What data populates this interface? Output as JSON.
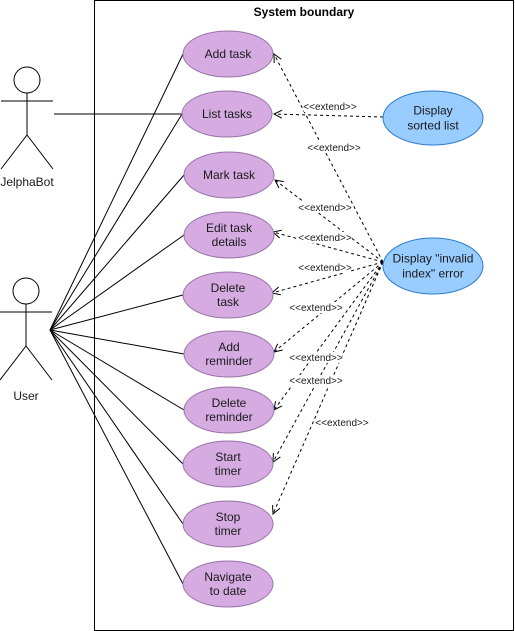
{
  "diagram": {
    "boundary_title": "System boundary",
    "colors": {
      "use_case_fill": "#d5abe2",
      "use_case_stroke": "#9673a6",
      "extension_fill": "#99ccff",
      "extension_stroke": "#2b7bd1"
    },
    "actors": [
      {
        "id": "jelphabot",
        "name": "JelphaBot"
      },
      {
        "id": "user",
        "name": "User"
      }
    ],
    "use_cases": [
      {
        "id": "add-task",
        "lines": [
          "Add task"
        ]
      },
      {
        "id": "list-tasks",
        "lines": [
          "List tasks"
        ]
      },
      {
        "id": "mark-task",
        "lines": [
          "Mark task"
        ]
      },
      {
        "id": "edit-task-details",
        "lines": [
          "Edit task",
          "details"
        ]
      },
      {
        "id": "delete-task",
        "lines": [
          "Delete",
          "task"
        ]
      },
      {
        "id": "add-reminder",
        "lines": [
          "Add",
          "reminder"
        ]
      },
      {
        "id": "delete-reminder",
        "lines": [
          "Delete",
          "reminder"
        ]
      },
      {
        "id": "start-timer",
        "lines": [
          "Start",
          "timer"
        ]
      },
      {
        "id": "stop-timer",
        "lines": [
          "Stop",
          "timer"
        ]
      },
      {
        "id": "navigate-to-date",
        "lines": [
          "Navigate",
          "to date"
        ]
      }
    ],
    "extension_cases": [
      {
        "id": "display-sorted-list",
        "lines": [
          "Display",
          "sorted list"
        ]
      },
      {
        "id": "display-invalid-index-error",
        "lines": [
          "Display \"invalid",
          "index\" error"
        ]
      }
    ],
    "associations": [
      {
        "from": "jelphabot",
        "to": "list-tasks"
      },
      {
        "from": "user",
        "to": "add-task"
      },
      {
        "from": "user",
        "to": "list-tasks"
      },
      {
        "from": "user",
        "to": "mark-task"
      },
      {
        "from": "user",
        "to": "edit-task-details"
      },
      {
        "from": "user",
        "to": "delete-task"
      },
      {
        "from": "user",
        "to": "add-reminder"
      },
      {
        "from": "user",
        "to": "delete-reminder"
      },
      {
        "from": "user",
        "to": "start-timer"
      },
      {
        "from": "user",
        "to": "stop-timer"
      },
      {
        "from": "user",
        "to": "navigate-to-date"
      }
    ],
    "extends": [
      {
        "from": "display-sorted-list",
        "to": "list-tasks",
        "label": "<<extend>>"
      },
      {
        "from": "display-invalid-index-error",
        "to": "add-task",
        "label": "<<extend>>"
      },
      {
        "from": "display-invalid-index-error",
        "to": "mark-task",
        "label": "<<extend>>"
      },
      {
        "from": "display-invalid-index-error",
        "to": "edit-task-details",
        "label": "<<extend>>"
      },
      {
        "from": "display-invalid-index-error",
        "to": "delete-task",
        "label": "<<extend>>"
      },
      {
        "from": "display-invalid-index-error",
        "to": "add-reminder",
        "label": "<<extend>>"
      },
      {
        "from": "display-invalid-index-error",
        "to": "delete-reminder",
        "label": "<<extend>>"
      },
      {
        "from": "display-invalid-index-error",
        "to": "start-timer",
        "label": "<<extend>>"
      },
      {
        "from": "display-invalid-index-error",
        "to": "stop-timer",
        "label": "<<extend>>"
      }
    ]
  }
}
